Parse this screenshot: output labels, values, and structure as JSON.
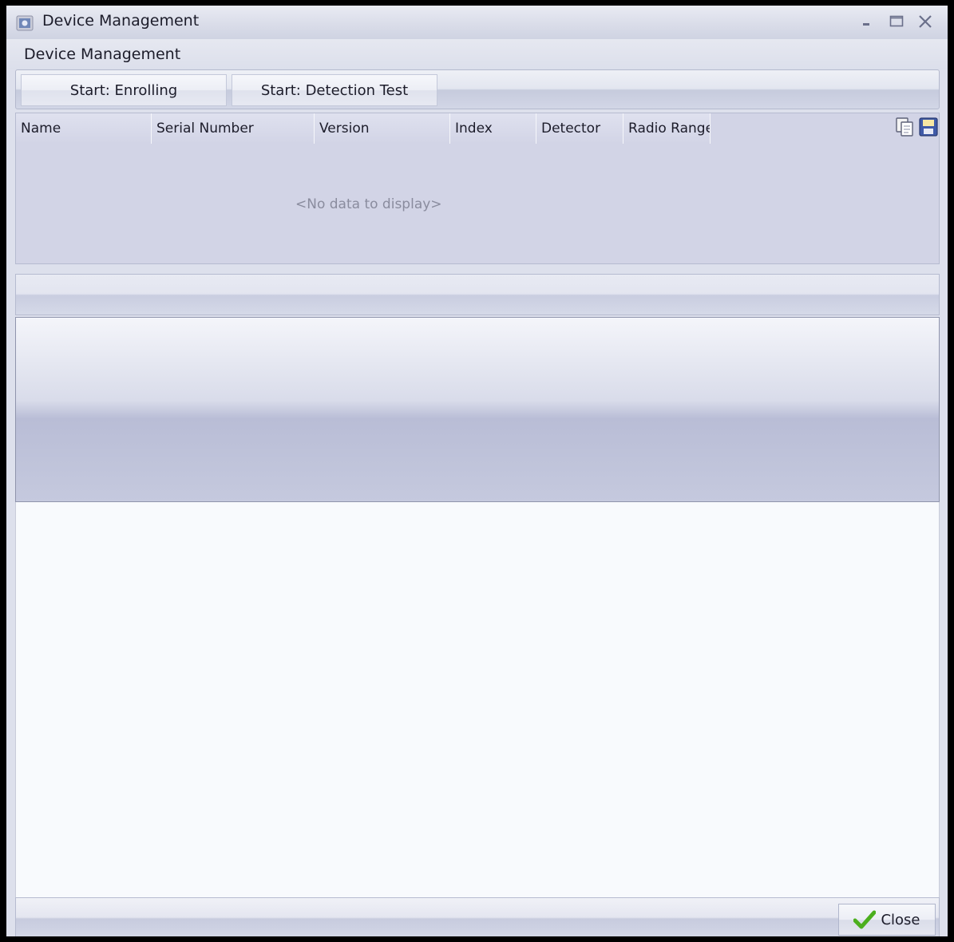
{
  "window": {
    "title": "Device Management",
    "controls": [
      "minimize-icon",
      "maximize-icon",
      "close-icon"
    ]
  },
  "header": {
    "title": "Device Management"
  },
  "toolbar": {
    "enroll_label": "Start: Enrolling",
    "detection_label": "Start: Detection Test"
  },
  "grid": {
    "columns": [
      "Name",
      "Serial Number",
      "Version",
      "Index",
      "Detector",
      "Radio Range"
    ],
    "empty_text": "<No data to display>",
    "tools": [
      "copy-icon",
      "save-icon"
    ]
  },
  "footer": {
    "close_label": "Close"
  },
  "colors": {
    "accent_check": "#4caf1e",
    "window_bg": "#dde0ec"
  }
}
